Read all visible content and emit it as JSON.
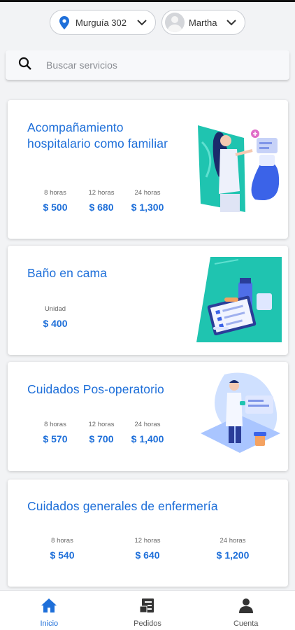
{
  "header": {
    "location": "Murguía 302",
    "user": "Martha"
  },
  "search": {
    "placeholder": "Buscar servicios"
  },
  "services": [
    {
      "title": "Acompañamiento hospitalario como familiar",
      "prices": [
        {
          "label": "8 horas",
          "value": "$ 500"
        },
        {
          "label": "12 horas",
          "value": "$ 680"
        },
        {
          "label": "24 horas",
          "value": "$ 1,300"
        }
      ]
    },
    {
      "title": "Baño en cama",
      "prices": [
        {
          "label": "Unidad",
          "value": "$ 400"
        }
      ]
    },
    {
      "title": "Cuidados Pos-operatorio",
      "prices": [
        {
          "label": "8 horas",
          "value": "$ 570"
        },
        {
          "label": "12 horas",
          "value": "$ 700"
        },
        {
          "label": "24 horas",
          "value": "$ 1,400"
        }
      ]
    },
    {
      "title": "Cuidados generales de enfermería",
      "prices": [
        {
          "label": "8 horas",
          "value": "$ 540"
        },
        {
          "label": "12 horas",
          "value": "$ 640"
        },
        {
          "label": "24 horas",
          "value": "$ 1,200"
        }
      ]
    }
  ],
  "nav": [
    {
      "label": "Inicio",
      "icon": "home-icon",
      "active": true
    },
    {
      "label": "Pedidos",
      "icon": "orders-icon",
      "active": false
    },
    {
      "label": "Cuenta",
      "icon": "account-icon",
      "active": false
    }
  ],
  "colors": {
    "accent": "#1e6fd9",
    "teal": "#1fc4b0"
  }
}
